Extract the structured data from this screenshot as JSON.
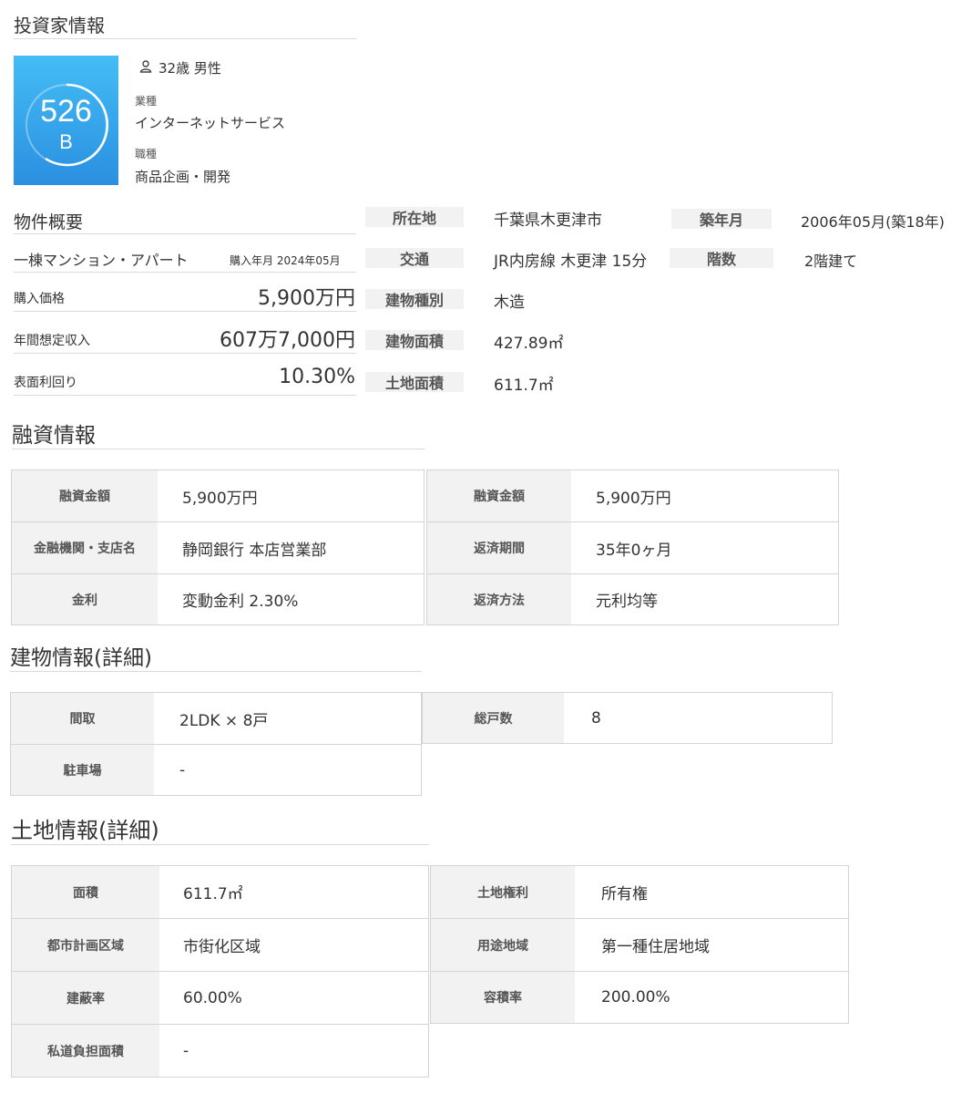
{
  "investor": {
    "title": "投資家情報",
    "score": "526",
    "grade": "B",
    "profile": "32歳 男性",
    "industry_label": "業種",
    "industry": "インターネットサービス",
    "job_label": "職種",
    "job": "商品企画・開発"
  },
  "property": {
    "title": "物件概要",
    "type": "一棟マンション・アパート",
    "purchase_date": "購入年月 2024年05月",
    "price_label": "購入価格",
    "price": "5,900万円",
    "income_label": "年間想定収入",
    "income": "607万7,000円",
    "yield_label": "表面利回り",
    "yield": "10.30%",
    "details": [
      {
        "label": "所在地",
        "value": "千葉県木更津市"
      },
      {
        "label": "交通",
        "value": "JR内房線 木更津 15分"
      },
      {
        "label": "建物種別",
        "value": "木造"
      },
      {
        "label": "建物面積",
        "value": "427.89㎡"
      },
      {
        "label": "土地面積",
        "value": "611.7㎡"
      },
      {
        "label": "築年月",
        "value": "2006年05月(築18年)"
      },
      {
        "label": "階数",
        "value": "2階建て"
      }
    ]
  },
  "loan": {
    "title": "融資情報",
    "left": [
      {
        "label": "融資金額",
        "value": "5,900万円"
      },
      {
        "label": "金融機関・支店名",
        "value": "静岡銀行 本店営業部"
      },
      {
        "label": "金利",
        "value": "変動金利 2.30%"
      }
    ],
    "right": [
      {
        "label": "融資金額",
        "value": "5,900万円"
      },
      {
        "label": "返済期間",
        "value": "35年0ヶ月"
      },
      {
        "label": "返済方法",
        "value": "元利均等"
      }
    ]
  },
  "building": {
    "title": "建物情報(詳細)",
    "left": [
      {
        "label": "間取",
        "value": "2LDK × 8戸"
      },
      {
        "label": "駐車場",
        "value": "-"
      }
    ],
    "right": [
      {
        "label": "総戸数",
        "value": "8"
      }
    ]
  },
  "land": {
    "title": "土地情報(詳細)",
    "left": [
      {
        "label": "面積",
        "value": "611.7㎡"
      },
      {
        "label": "都市計画区域",
        "value": "市街化区域"
      },
      {
        "label": "建蔽率",
        "value": "60.00%"
      },
      {
        "label": "私道負担面積",
        "value": "-"
      }
    ],
    "right": [
      {
        "label": "土地権利",
        "value": "所有権"
      },
      {
        "label": "用途地域",
        "value": "第一種住居地域"
      },
      {
        "label": "容積率",
        "value": "200.00%"
      }
    ]
  }
}
